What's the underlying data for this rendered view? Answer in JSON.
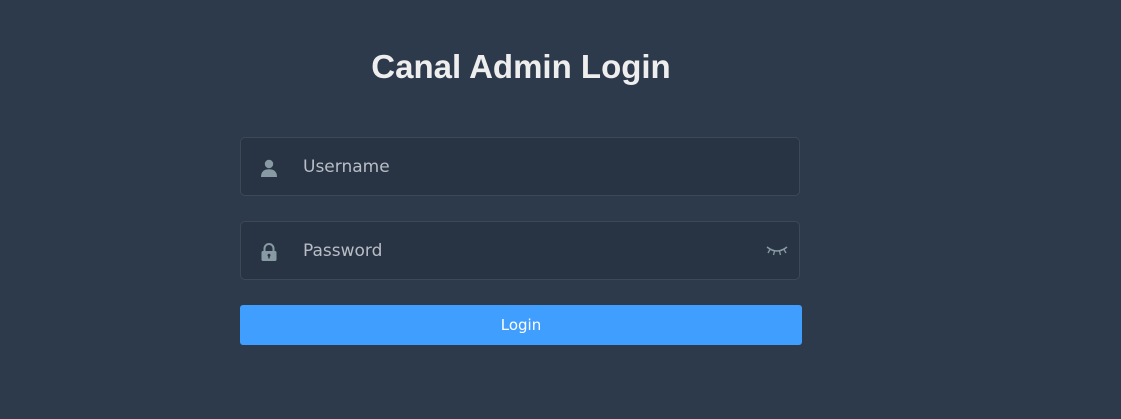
{
  "title": "Canal Admin Login",
  "form": {
    "username": {
      "value": "",
      "placeholder": "Username",
      "icon": "user-icon"
    },
    "password": {
      "value": "",
      "placeholder": "Password",
      "icon": "lock-icon",
      "toggle_icon": "eye-closed-icon"
    },
    "login_label": "Login"
  },
  "colors": {
    "background": "#2d3a4b",
    "input_background": "#283443",
    "accent": "#409eff",
    "title": "#eeeeee",
    "icon": "#889aa4"
  }
}
